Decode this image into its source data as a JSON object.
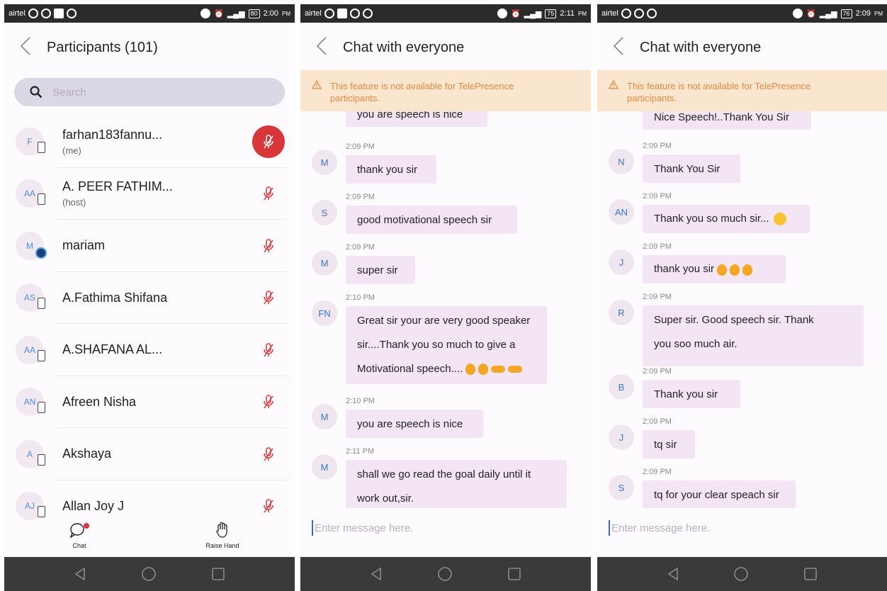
{
  "colors": {
    "accent_red": "#d9363a",
    "bubble": "#f3e5f3",
    "warning_bg": "#fae6cf",
    "warning_text": "#e48a3f",
    "avatar_text": "#3a78c2"
  },
  "status_bars": [
    {
      "carrier": "airtel",
      "battery": "80",
      "time": "2:00",
      "ampm": "PM"
    },
    {
      "carrier": "airtel",
      "battery": "75",
      "time": "2:11",
      "ampm": "PM"
    },
    {
      "carrier": "airtel",
      "battery": "76",
      "time": "2:09",
      "ampm": "PM"
    }
  ],
  "participants_screen": {
    "title": "Participants (101)",
    "search_placeholder": "Search",
    "participants": [
      {
        "initials": "F",
        "name": "farhan183fannu...",
        "role": "(me)",
        "device": "phone-icon",
        "mic": "muted-active"
      },
      {
        "initials": "AA",
        "name": "A. PEER FATHIM...",
        "role": "(host)",
        "device": "phone-icon",
        "mic": "muted"
      },
      {
        "initials": "M",
        "name": "mariam",
        "role": "",
        "device": "globe-icon",
        "mic": "muted"
      },
      {
        "initials": "AS",
        "name": "A.Fathima Shifana",
        "role": "",
        "device": "phone-icon",
        "mic": "muted"
      },
      {
        "initials": "AA",
        "name": "A.SHAFANA AL...",
        "role": "",
        "device": "phone-icon",
        "mic": "muted"
      },
      {
        "initials": "AN",
        "name": "Afreen Nisha",
        "role": "",
        "device": "phone-icon",
        "mic": "muted"
      },
      {
        "initials": "A",
        "name": "Akshaya",
        "role": "",
        "device": "phone-icon",
        "mic": "muted"
      },
      {
        "initials": "AJ",
        "name": "Allan Joy J",
        "role": "",
        "device": "phone-icon",
        "mic": "muted"
      }
    ],
    "bottom_bar": {
      "chat_label": "Chat",
      "raise_hand_label": "Raise Hand"
    }
  },
  "chat_screens": [
    {
      "title": "Chat with everyone",
      "warning": "This feature is not available for TelePresence participants.",
      "messages": [
        {
          "initials": "",
          "time": "",
          "lines": [
            "you are speech is nice"
          ],
          "emoji": ""
        },
        {
          "initials": "M",
          "time": "2:09 PM",
          "lines": [
            "thank you sir"
          ],
          "emoji": ""
        },
        {
          "initials": "S",
          "time": "2:09 PM",
          "lines": [
            "good motivational speech sir"
          ],
          "emoji": ""
        },
        {
          "initials": "M",
          "time": "2:09 PM",
          "lines": [
            "super sir"
          ],
          "emoji": ""
        },
        {
          "initials": "FN",
          "time": "2:10 PM",
          "lines": [
            "Great sir your are very good speaker",
            "sir....Thank you so much to give a",
            "Motivational speech...."
          ],
          "emoji": "ok-ok-point-point"
        },
        {
          "initials": "M",
          "time": "2:10 PM",
          "lines": [
            "you are speech is nice"
          ],
          "emoji": ""
        },
        {
          "initials": "M",
          "time": "2:11 PM",
          "lines": [
            "shall we go read the goal daily until it",
            "work out,sir."
          ],
          "emoji": ""
        }
      ],
      "composer_placeholder": "Enter message here."
    },
    {
      "title": "Chat with everyone",
      "warning": "This feature is not available for TelePresence participants.",
      "messages": [
        {
          "initials": "",
          "time": "",
          "lines": [
            "Nice Speech!..Thank You Sir"
          ],
          "emoji": ""
        },
        {
          "initials": "N",
          "time": "2:09 PM",
          "lines": [
            "Thank You Sir"
          ],
          "emoji": ""
        },
        {
          "initials": "AN",
          "time": "2:09 PM",
          "lines": [
            "Thank you so much sir..."
          ],
          "emoji": "smile"
        },
        {
          "initials": "J",
          "time": "2:09 PM",
          "lines": [
            "thank you sir"
          ],
          "emoji": "ok-ok-ok"
        },
        {
          "initials": "R",
          "time": "2:09 PM",
          "lines": [
            "Super sir. Good  speech sir. Thank",
            "you soo much air."
          ],
          "emoji": ""
        },
        {
          "initials": "B",
          "time": "2:09 PM",
          "lines": [
            "Thank you  sir"
          ],
          "emoji": ""
        },
        {
          "initials": "J",
          "time": "2:09 PM",
          "lines": [
            "tq sir"
          ],
          "emoji": ""
        },
        {
          "initials": "S",
          "time": "2:09 PM",
          "lines": [
            "tq for your clear speach sir"
          ],
          "emoji": ""
        }
      ],
      "composer_placeholder": "Enter message here."
    }
  ]
}
